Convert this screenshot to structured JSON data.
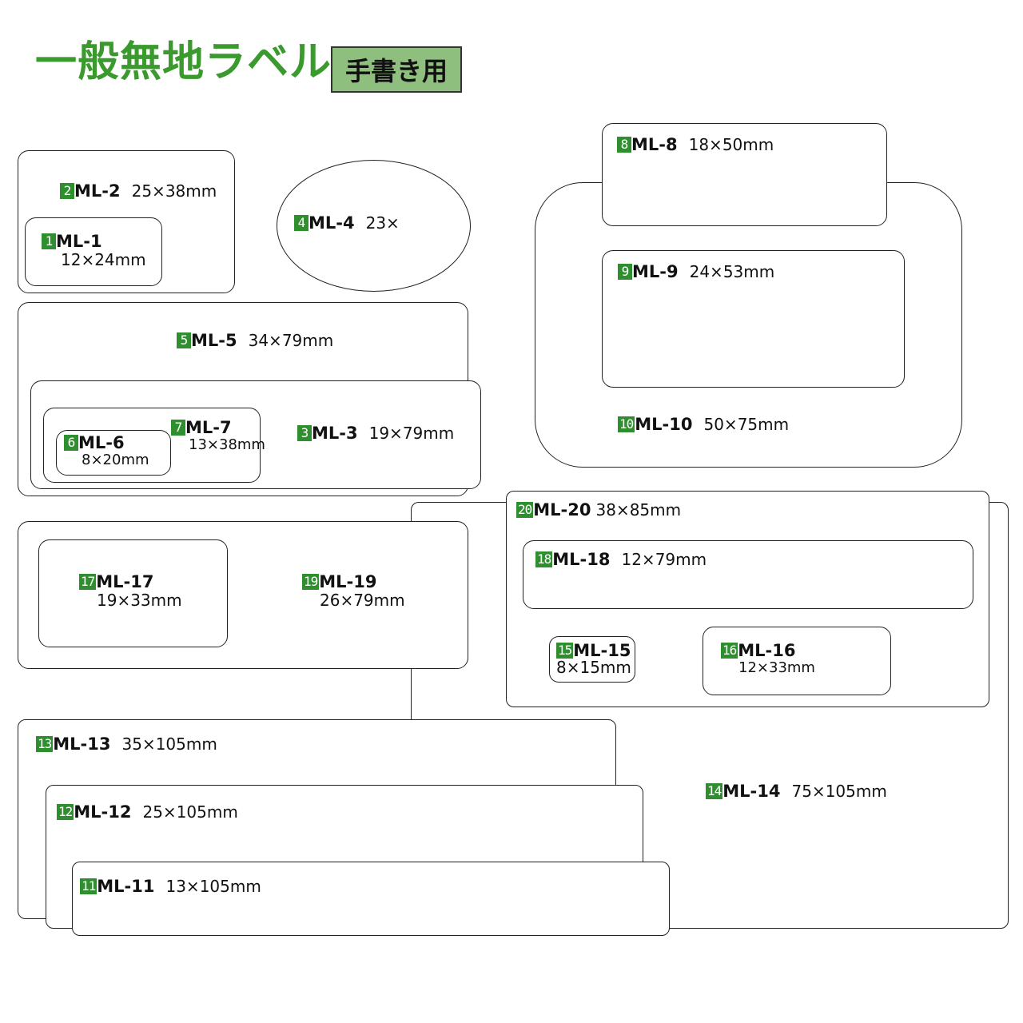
{
  "header": {
    "title": "一般無地ラベル",
    "badge": "手書き用"
  },
  "labels": {
    "ml1": {
      "num": "1",
      "code": "ML-1",
      "size": "12×24mm"
    },
    "ml2": {
      "num": "2",
      "code": "ML-2",
      "size": "25×38mm"
    },
    "ml3": {
      "num": "3",
      "code": "ML-3",
      "size": "19×79mm"
    },
    "ml4": {
      "num": "4",
      "code": "ML-4",
      "size": "23×"
    },
    "ml5": {
      "num": "5",
      "code": "ML-5",
      "size": "34×79mm"
    },
    "ml6": {
      "num": "6",
      "code": "ML-6",
      "size": "8×20mm"
    },
    "ml7": {
      "num": "7",
      "code": "ML-7",
      "size": "13×38mm"
    },
    "ml8": {
      "num": "8",
      "code": "ML-8",
      "size": "18×50mm"
    },
    "ml9": {
      "num": "9",
      "code": "ML-9",
      "size": "24×53mm"
    },
    "ml10": {
      "num": "10",
      "code": "ML-10",
      "size": "50×75mm"
    },
    "ml11": {
      "num": "11",
      "code": "ML-11",
      "size": "13×105mm"
    },
    "ml12": {
      "num": "12",
      "code": "ML-12",
      "size": "25×105mm"
    },
    "ml13": {
      "num": "13",
      "code": "ML-13",
      "size": "35×105mm"
    },
    "ml14": {
      "num": "14",
      "code": "ML-14",
      "size": "75×105mm"
    },
    "ml15": {
      "num": "15",
      "code": "ML-15",
      "size": "8×15mm"
    },
    "ml16": {
      "num": "16",
      "code": "ML-16",
      "size": "12×33mm"
    },
    "ml17": {
      "num": "17",
      "code": "ML-17",
      "size": "19×33mm"
    },
    "ml18": {
      "num": "18",
      "code": "ML-18",
      "size": "12×79mm"
    },
    "ml19": {
      "num": "19",
      "code": "ML-19",
      "size": "26×79mm"
    },
    "ml20": {
      "num": "20",
      "code": "ML-20",
      "size": "38×85mm"
    }
  },
  "colors": {
    "title": "#3a9a2e",
    "badge_bg": "#8fbf7f",
    "number_bg": "#2f8f2f"
  }
}
